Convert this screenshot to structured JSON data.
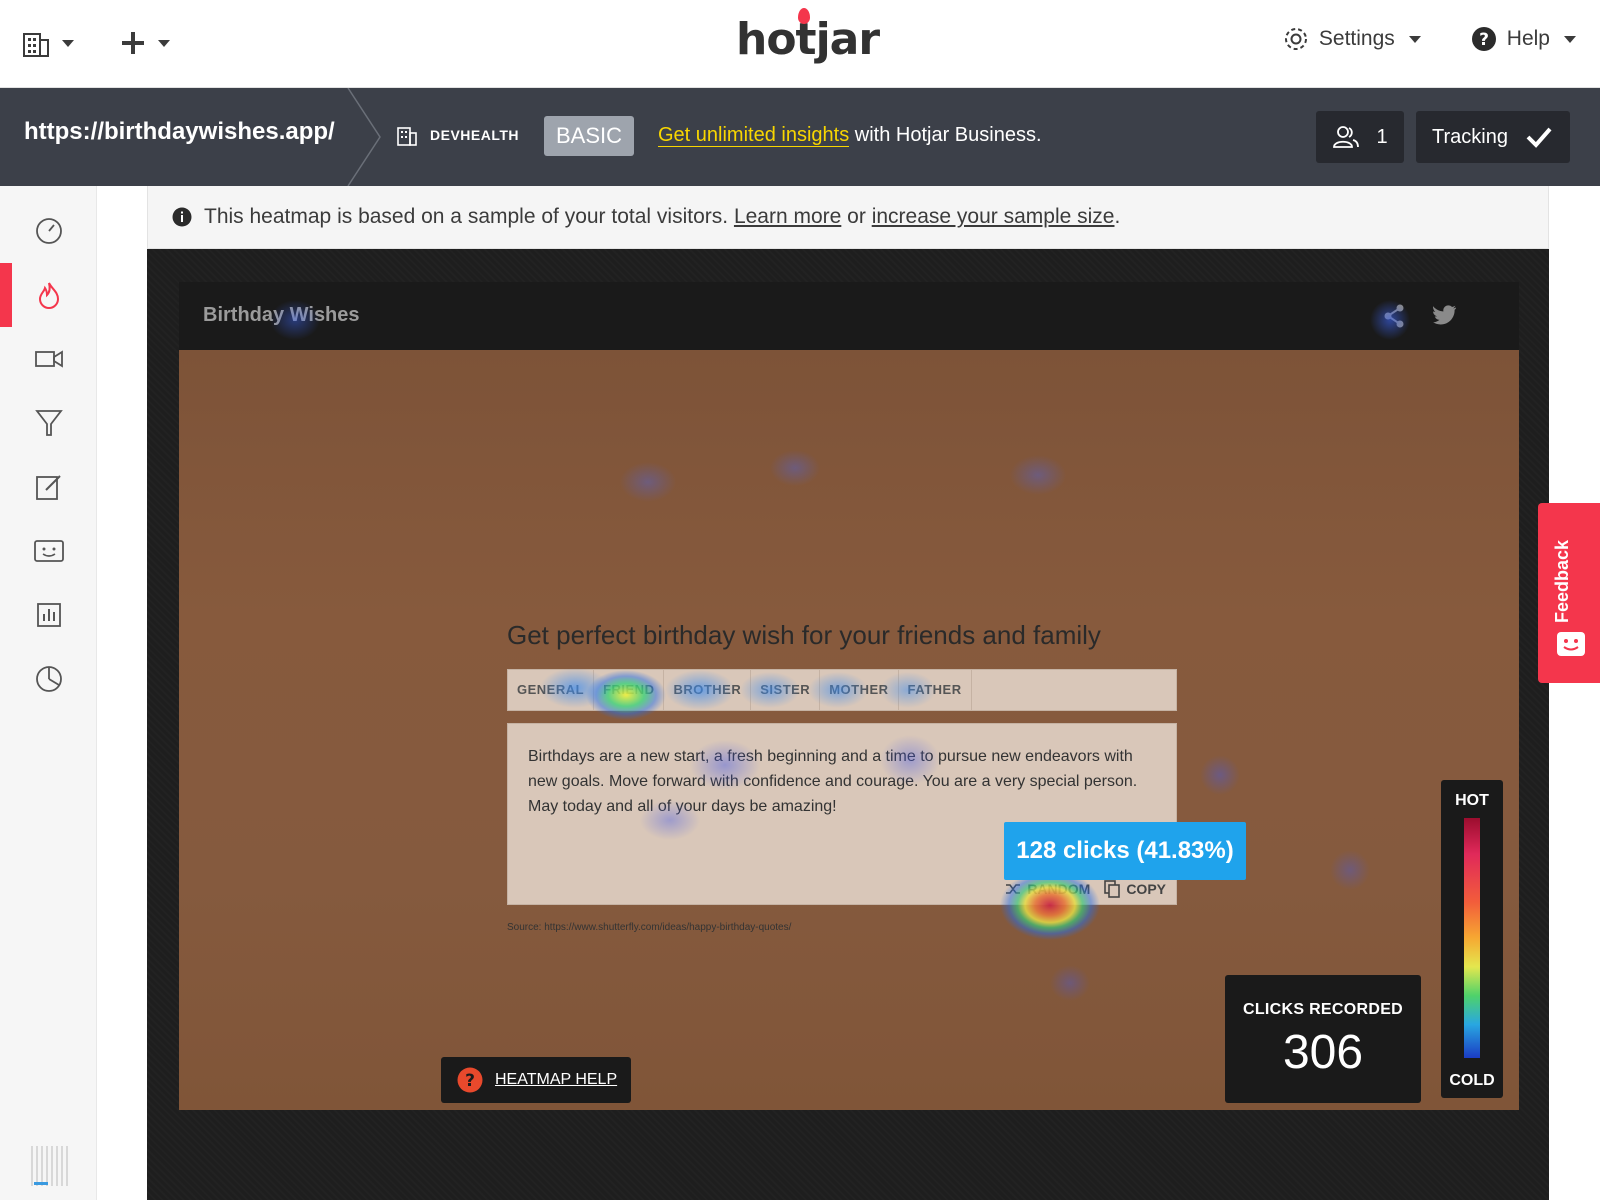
{
  "topbar": {
    "brand": "hotjar",
    "settings_label": "Settings",
    "help_label": "Help"
  },
  "subbar": {
    "site_url": "https://birthdaywishes.app/",
    "organization": "DEVHEALTH",
    "plan_badge": "BASIC",
    "promo_link": "Get unlimited insights",
    "promo_rest": " with Hotjar Business.",
    "users_count": "1",
    "tracking_label": "Tracking"
  },
  "sidebar": {
    "items": [
      {
        "icon": "dashboard-icon"
      },
      {
        "icon": "heatmaps-icon",
        "active": true
      },
      {
        "icon": "recordings-icon"
      },
      {
        "icon": "funnels-icon"
      },
      {
        "icon": "forms-icon"
      },
      {
        "icon": "feedback-polls-icon"
      },
      {
        "icon": "surveys-icon"
      },
      {
        "icon": "analytics-icon"
      }
    ]
  },
  "notice": {
    "text": "This heatmap is based on a sample of your total visitors.",
    "learn_more": "Learn more",
    "or": "or",
    "increase_link": "increase your sample size",
    "period": "."
  },
  "mock_site": {
    "title": "Birthday Wishes",
    "headline": "Get perfect birthday wish for your friends and family",
    "tabs": [
      "GENERAL",
      "FRIEND",
      "BROTHER",
      "SISTER",
      "MOTHER",
      "FATHER"
    ],
    "quote": "Birthdays are a new start, a fresh beginning and a time to pursue new endeavors with new goals. Move forward with confidence and courage. You are a very special person. May today and all of your days be amazing!",
    "random_label": "RANDOM",
    "copy_label": "COPY",
    "source": "Source: https://www.shutterfly.com/ideas/happy-birthday-quotes/"
  },
  "tooltip": {
    "text": "128 clicks (41.83%)"
  },
  "heatmap_help": "HEATMAP HELP",
  "clicks": {
    "label": "CLICKS RECORDED",
    "value": "306"
  },
  "legend": {
    "hot": "HOT",
    "cold": "COLD"
  },
  "feedback_tab": "Feedback",
  "colors": {
    "accent": "#f4364c",
    "subbar": "#3c4049",
    "promo": "#f8d600",
    "tooltip": "#1fa3ec"
  }
}
